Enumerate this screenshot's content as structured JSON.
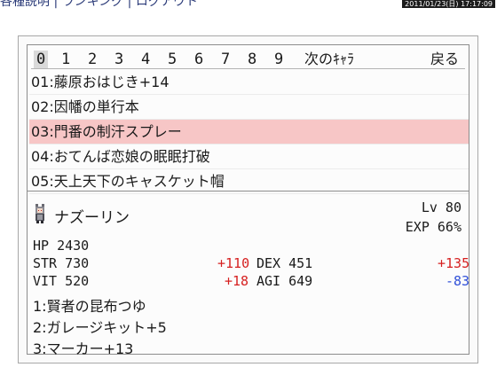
{
  "top": {
    "nav_text": "各種説明 | ランキング | ログアウト",
    "datetime": "2011/01/23(日) 17:17:09"
  },
  "tabs": [
    {
      "label": "0",
      "active": true
    },
    {
      "label": "1"
    },
    {
      "label": "2"
    },
    {
      "label": "3"
    },
    {
      "label": "4"
    },
    {
      "label": "5"
    },
    {
      "label": "6"
    },
    {
      "label": "7"
    },
    {
      "label": "8"
    },
    {
      "label": "9"
    }
  ],
  "next_char_label": "次のｷｬﾗ",
  "back_label": "戻る",
  "items": [
    {
      "text": "01:藤原おはじき+14",
      "selected": false
    },
    {
      "text": "02:因幡の単行本",
      "selected": false
    },
    {
      "text": "03:門番の制汗スプレー",
      "selected": true
    },
    {
      "text": "04:おてんば恋娘の眠眠打破",
      "selected": false
    },
    {
      "text": "05:天上天下のキャスケット帽",
      "selected": false
    }
  ],
  "character": {
    "name": "ナズーリン",
    "level_label": "Lv 80",
    "exp_label": "EXP 66%",
    "hp_label": "HP  2430",
    "str_label": "STR 730",
    "str_mod": "+110",
    "dex_label": "DEX 451",
    "dex_mod": "+135",
    "vit_label": "VIT 520",
    "vit_mod": "+18",
    "agi_label": "AGI 649",
    "agi_mod": "-83",
    "equipment": [
      "1:賢者の昆布つゆ",
      "2:ガレージキット+5",
      "3:マーカー+13"
    ]
  }
}
